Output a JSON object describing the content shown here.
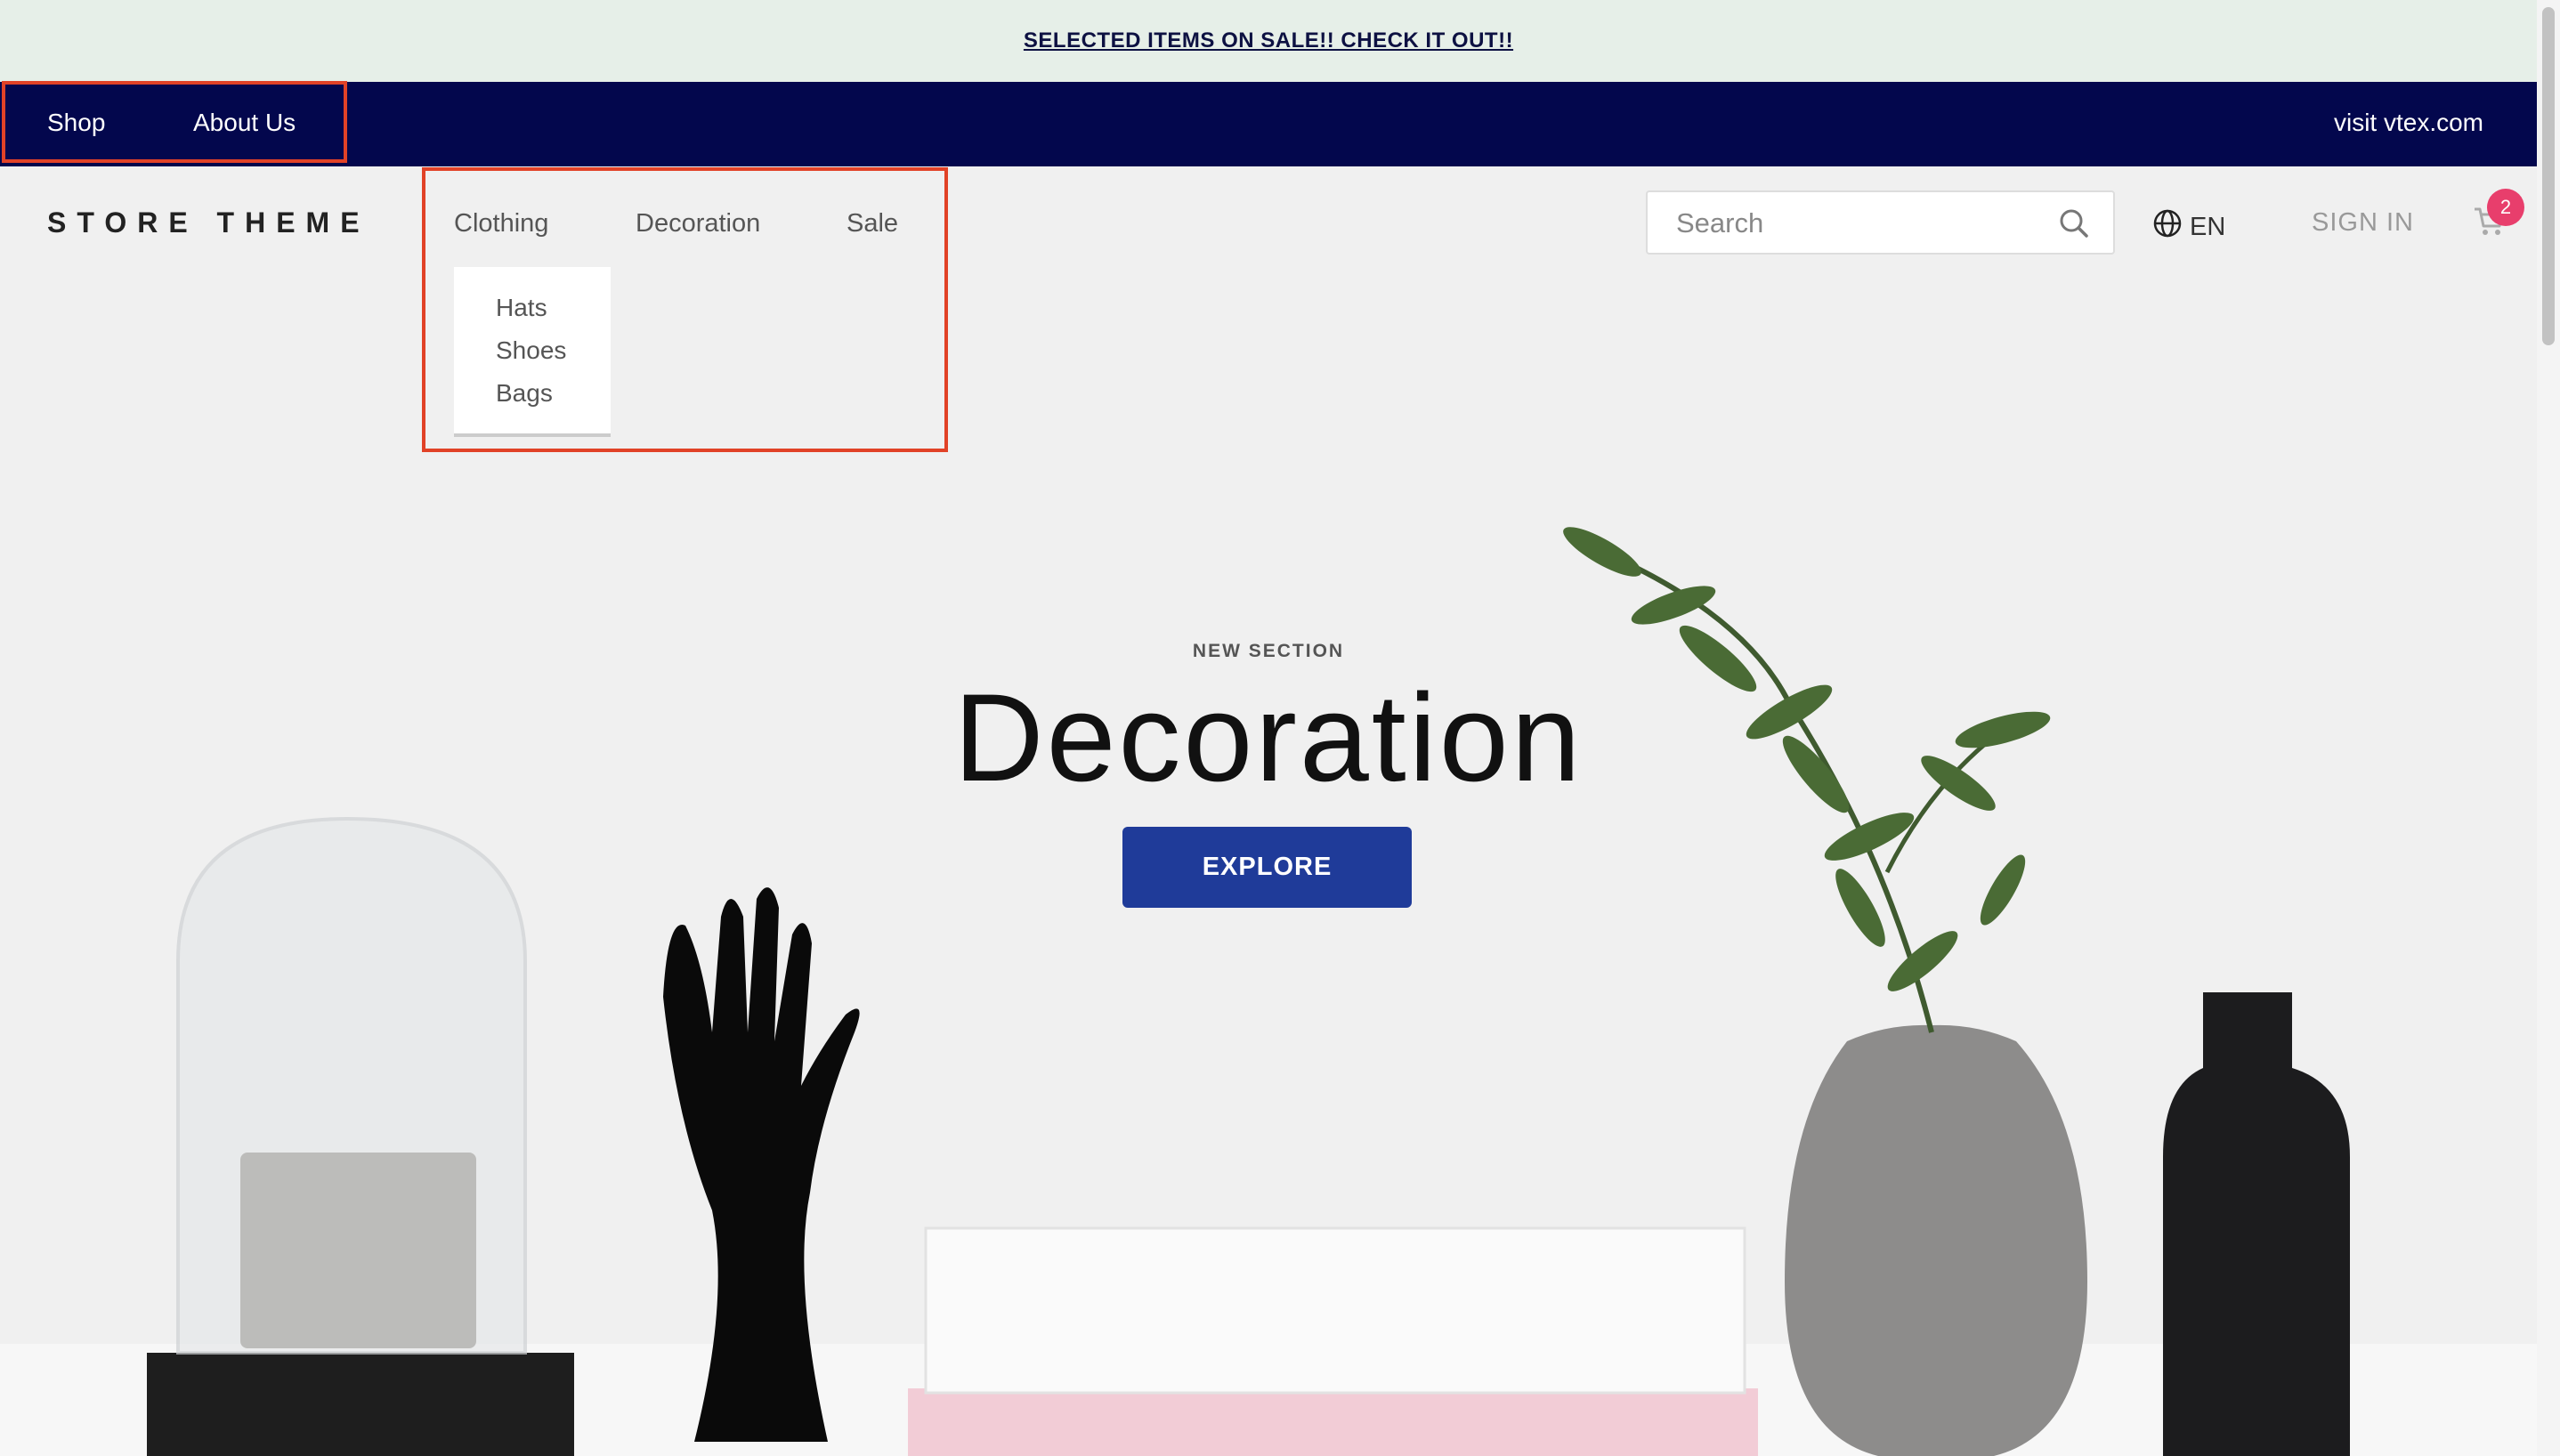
{
  "promo": {
    "text": "SELECTED ITEMS ON SALE!! CHECK IT OUT!!"
  },
  "topnav": {
    "shop": "Shop",
    "about": "About Us",
    "visit": "visit vtex.com"
  },
  "header": {
    "logo": "STORE THEME",
    "menu": [
      "Clothing",
      "Decoration",
      "Sale"
    ],
    "submenu": [
      "Hats",
      "Shoes",
      "Bags"
    ],
    "search_placeholder": "Search",
    "language": "EN",
    "signin": "SIGN IN",
    "cart_count": "2"
  },
  "hero": {
    "label": "NEW SECTION",
    "title": "Decoration",
    "button": "EXPLORE"
  },
  "colors": {
    "promo_bg": "#e6efe8",
    "topnav_bg": "#03074d",
    "accent_button": "#1f3b99",
    "badge": "#e83e6c",
    "highlight_border": "#e14227"
  }
}
